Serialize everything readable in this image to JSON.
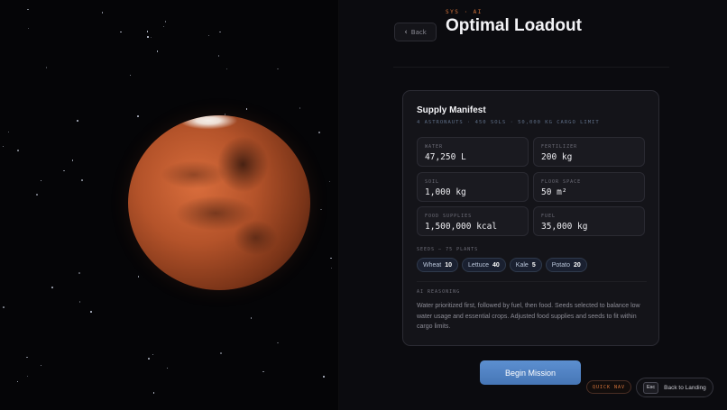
{
  "header": {
    "eyebrow": "SYS · AI",
    "title": "Optimal Loadout",
    "back_label": "Back"
  },
  "manifest": {
    "title": "Supply Manifest",
    "subtitle": "4 ASTRONAUTS · 450 SOLS · 50,000 KG CARGO LIMIT",
    "stats": [
      {
        "label": "WATER",
        "value": "47,250 L"
      },
      {
        "label": "FERTILIZER",
        "value": "200 kg"
      },
      {
        "label": "SOIL",
        "value": "1,000 kg"
      },
      {
        "label": "FLOOR SPACE",
        "value": "50 m²"
      },
      {
        "label": "FOOD SUPPLIES",
        "value": "1,500,000 kcal"
      },
      {
        "label": "FUEL",
        "value": "35,000 kg"
      }
    ],
    "seeds_label": "SEEDS — 75 PLANTS",
    "seeds": [
      {
        "name": "Wheat",
        "count": "10"
      },
      {
        "name": "Lettuce",
        "count": "40"
      },
      {
        "name": "Kale",
        "count": "5"
      },
      {
        "name": "Potato",
        "count": "20"
      }
    ],
    "ai_label": "AI REASONING",
    "ai_text": "Water prioritized first, followed by fuel, then food. Seeds selected to balance low water usage and essential crops. Adjusted food supplies and seeds to fit within cargo limits."
  },
  "actions": {
    "begin_label": "Begin Mission",
    "quick_nav_label": "QUICK NAV",
    "esc_key": "Esc",
    "back_to_landing_label": "Back to Landing"
  },
  "visual": {
    "planet": "mars",
    "accent_color": "#d9753c",
    "primary_button_color": "#5084c4",
    "icons": {
      "back": "chevron-left-icon"
    }
  }
}
